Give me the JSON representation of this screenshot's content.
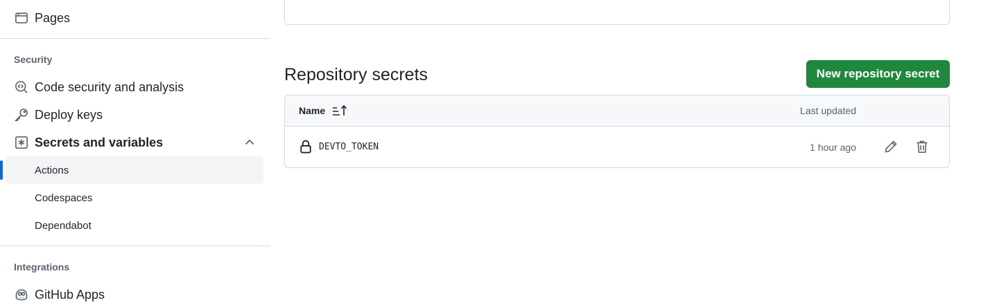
{
  "sidebar": {
    "pages_label": "Pages",
    "security_heading": "Security",
    "code_security_label": "Code security and analysis",
    "deploy_keys_label": "Deploy keys",
    "secrets_label": "Secrets and variables",
    "actions_label": "Actions",
    "codespaces_label": "Codespaces",
    "dependabot_label": "Dependabot",
    "integrations_heading": "Integrations",
    "github_apps_label": "GitHub Apps",
    "icons": {
      "pages": "browser-icon",
      "code_security": "codescan-icon",
      "deploy_keys": "key-icon",
      "secrets": "asterisk-icon",
      "github_apps": "copilot-icon",
      "collapse": "chevron-up-icon"
    }
  },
  "main": {
    "section_title": "Repository secrets",
    "new_button_label": "New repository secret",
    "table": {
      "header_name": "Name",
      "header_updated": "Last updated",
      "rows": [
        {
          "name": "DEVTO_TOKEN",
          "updated": "1 hour ago"
        }
      ]
    }
  },
  "colors": {
    "accent": "#0969da",
    "primary_button": "#1f883d",
    "border": "#d1d9e0",
    "muted_text": "#59636e",
    "header_bg": "#f6f8fa"
  }
}
